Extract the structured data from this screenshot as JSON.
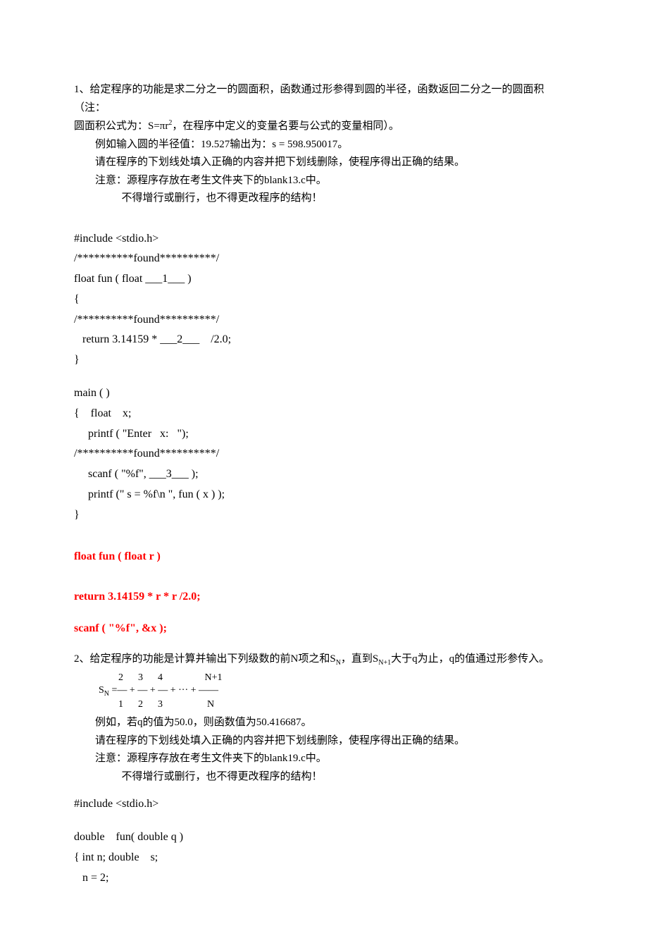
{
  "q1": {
    "desc_line1": "1、给定程序的功能是求二分之一的圆面积，函数通过形参得到圆的半径，函数返回二分之一的圆面积（注：",
    "desc_line2_a": "圆面积公式为：S=πr",
    "desc_line2_sup": "2",
    "desc_line2_b": "，在程序中定义的变量名要与公式的变量相同）。",
    "example": "例如输入圆的半径值：19.527输出为：s = 598.950017。",
    "instr1": "请在程序的下划线处填入正确的内容并把下划线删除，使程序得出正确的结果。",
    "instr2": "注意：源程序存放在考生文件夹下的blank13.c中。",
    "instr3": "不得增行或删行，也不得更改程序的结构！",
    "code": {
      "l1": "#include <stdio.h>",
      "l2": "/**********found**********/",
      "l3": "float fun ( float ___1___ )",
      "l4": "{",
      "l5": "/**********found**********/",
      "l6": "   return 3.14159 * ___2___    /2.0;",
      "l7": "}",
      "l8": "main ( )",
      "l9": "{    float    x;",
      "l10": "     printf ( \"Enter   x:   \");",
      "l11": "/**********found**********/",
      "l12": "     scanf ( \"%f\", ___3___ );",
      "l13": "     printf (\" s = %f\\n \", fun ( x ) );",
      "l14": "}"
    },
    "ans1": "float fun ( float r )",
    "ans2": "return 3.14159 * r * r /2.0;",
    "ans3": "scanf ( \"%f\", &x );"
  },
  "q2": {
    "desc_a": "2、给定程序的功能是计算并输出下列级数的前N项之和S",
    "desc_sub1": "N",
    "desc_b": "，直到S",
    "desc_sub2": "N+1",
    "desc_c": "大于q为止，q的值通过形参传入。",
    "formula_top": "        2      3      4                 N+1",
    "formula_mid": "SN =— + — + — + ··· + ——",
    "formula_bot": "        1      2      3                  N",
    "example": "例如，若q的值为50.0，则函数值为50.416687。",
    "instr1": "请在程序的下划线处填入正确的内容并把下划线删除，使程序得出正确的结果。",
    "instr2": "注意：源程序存放在考生文件夹下的blank19.c中。",
    "instr3": "不得增行或删行，也不得更改程序的结构！",
    "code": {
      "l1": "#include <stdio.h>",
      "l2": "double    fun( double q )",
      "l3": "{ int n; double    s;",
      "l4": "   n = 2;"
    }
  }
}
